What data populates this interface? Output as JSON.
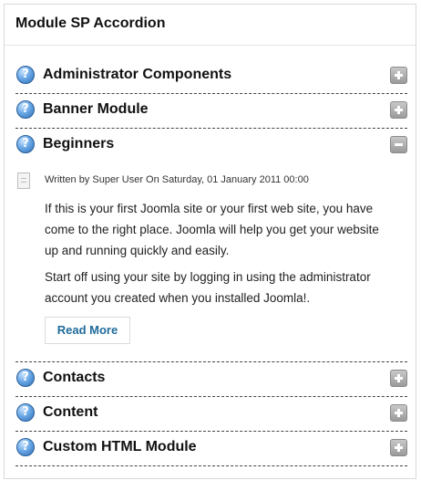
{
  "module": {
    "title": "Module SP Accordion"
  },
  "accordion": {
    "items": [
      {
        "label": "Administrator Components",
        "state": "collapsed",
        "icon": "question-icon",
        "toggle_icon": "plus-icon"
      },
      {
        "label": "Banner Module",
        "state": "collapsed",
        "icon": "question-icon",
        "toggle_icon": "plus-icon"
      },
      {
        "label": "Beginners",
        "state": "expanded",
        "icon": "question-icon",
        "toggle_icon": "minus-icon"
      },
      {
        "label": "Contacts",
        "state": "collapsed",
        "icon": "question-icon",
        "toggle_icon": "plus-icon"
      },
      {
        "label": "Content",
        "state": "collapsed",
        "icon": "question-icon",
        "toggle_icon": "plus-icon"
      },
      {
        "label": "Custom HTML Module",
        "state": "collapsed",
        "icon": "question-icon",
        "toggle_icon": "plus-icon"
      }
    ],
    "expanded_content": {
      "meta": "Written by Super User On Saturday, 01 January 2011 00:00",
      "paragraphs": [
        "If this is your first Joomla site or your first web site, you have come to the right place. Joomla will help you get your website up and running quickly and easily.",
        "Start off using your site by logging in using the administrator account you created when you installed Joomla!."
      ],
      "read_more_label": "Read More"
    }
  },
  "colors": {
    "link": "#1f6b9a",
    "icon_blue": "#2f6fb5",
    "toggle_gray": "#9a9a9a"
  }
}
